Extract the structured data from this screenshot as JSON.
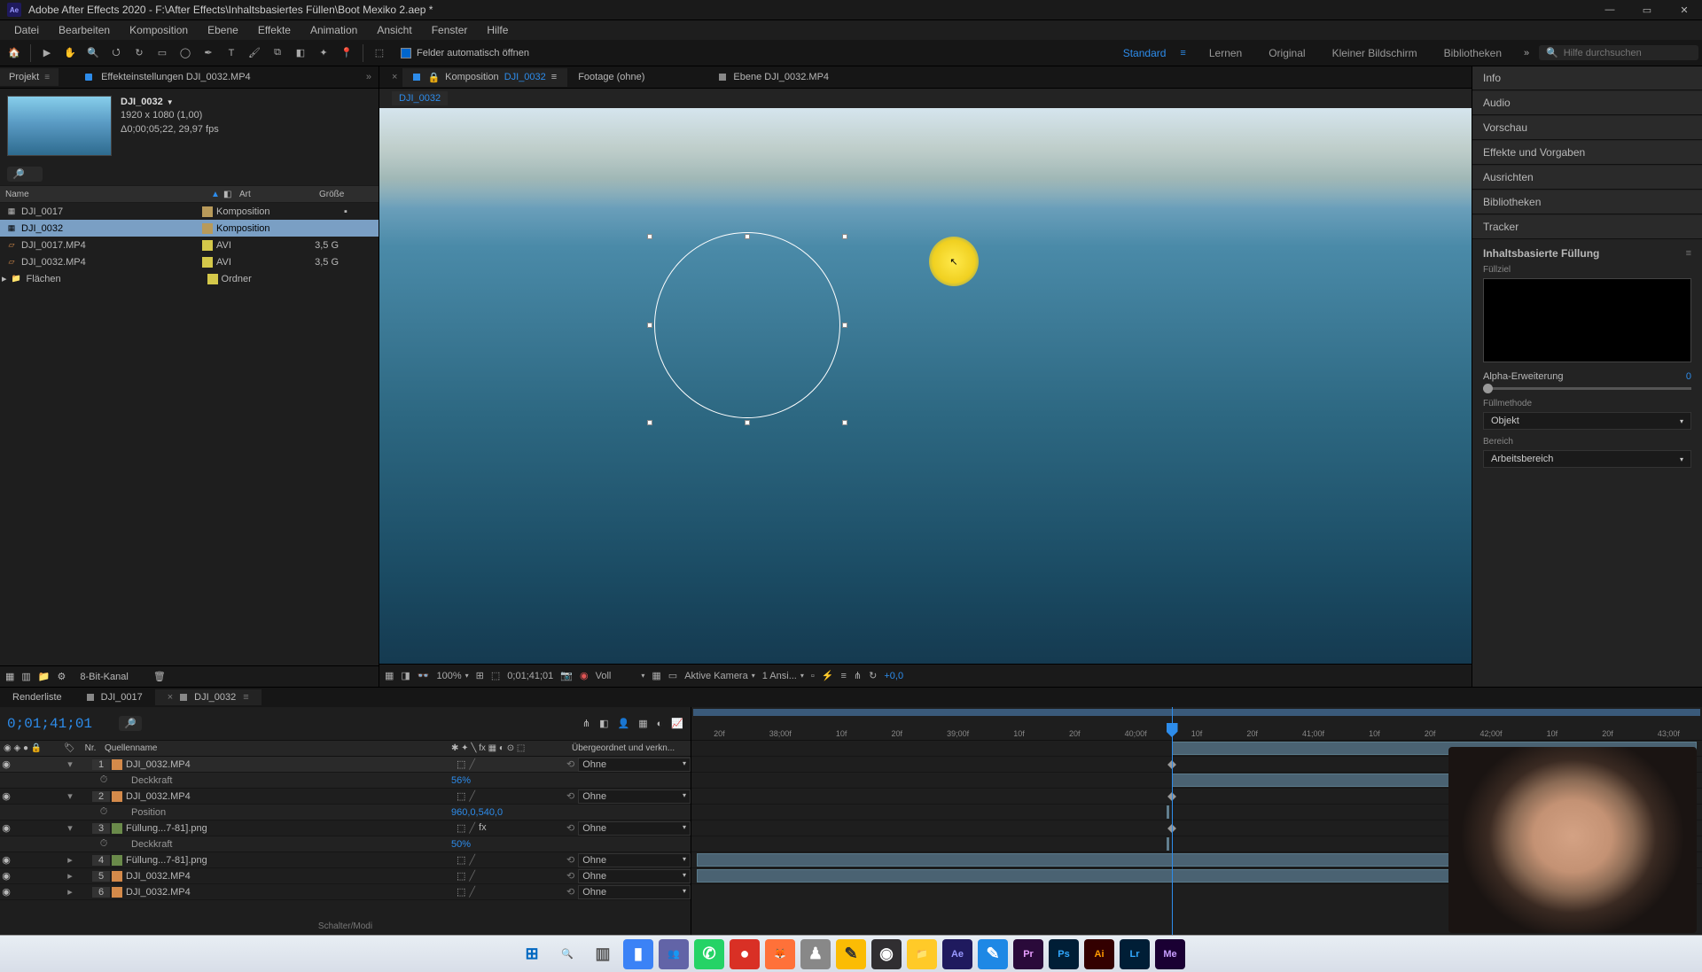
{
  "window": {
    "title": "Adobe After Effects 2020 - F:\\After Effects\\Inhaltsbasiertes Füllen\\Boot Mexiko 2.aep *",
    "app_abbrev": "Ae"
  },
  "menu": [
    "Datei",
    "Bearbeiten",
    "Komposition",
    "Ebene",
    "Effekte",
    "Animation",
    "Ansicht",
    "Fenster",
    "Hilfe"
  ],
  "toolbar": {
    "auto_open_fields": "Felder automatisch öffnen",
    "workspaces": [
      "Standard",
      "Lernen",
      "Original",
      "Kleiner Bildschirm",
      "Bibliotheken"
    ],
    "active_workspace": "Standard",
    "search_placeholder": "Hilfe durchsuchen"
  },
  "project_panel": {
    "tab_project": "Projekt",
    "tab_effect_controls": "Effekteinstellungen DJI_0032.MP4",
    "comp_name": "DJI_0032",
    "resolution": "1920 x 1080 (1,00)",
    "duration": "Δ0;00;05;22, 29,97 fps",
    "columns": {
      "name": "Name",
      "type": "Art",
      "size": "Größe"
    },
    "items": [
      {
        "name": "DJI_0017",
        "type": "Komposition",
        "size": "",
        "color": "#b89a5a",
        "icon": "comp"
      },
      {
        "name": "DJI_0032",
        "type": "Komposition",
        "size": "",
        "color": "#b89a5a",
        "icon": "comp",
        "selected": true
      },
      {
        "name": "DJI_0017.MP4",
        "type": "AVI",
        "size": "3,5 G",
        "color": "#d4c84a",
        "icon": "footage"
      },
      {
        "name": "DJI_0032.MP4",
        "type": "AVI",
        "size": "3,5 G",
        "color": "#d4c84a",
        "icon": "footage"
      },
      {
        "name": "Flächen",
        "type": "Ordner",
        "size": "",
        "color": "#d4c84a",
        "icon": "folder"
      }
    ],
    "footer_label": "8-Bit-Kanal"
  },
  "composition_panel": {
    "tab_comp_prefix": "Komposition",
    "tab_comp_name": "DJI_0032",
    "tab_footage": "Footage (ohne)",
    "tab_layer": "Ebene DJI_0032.MP4",
    "breadcrumb": "DJI_0032",
    "footer": {
      "zoom": "100%",
      "timecode": "0;01;41;01",
      "resolution": "Voll",
      "camera": "Aktive Kamera",
      "views": "1 Ansi...",
      "exposure": "+0,0"
    }
  },
  "right_panel": {
    "sections": [
      "Info",
      "Audio",
      "Vorschau",
      "Effekte und Vorgaben",
      "Ausrichten",
      "Bibliotheken",
      "Tracker"
    ],
    "caf": {
      "title": "Inhaltsbasierte Füllung",
      "fill_target": "Füllziel",
      "alpha_label": "Alpha-Erweiterung",
      "alpha_value": "0",
      "method_label": "Füllmethode",
      "method_value": "Objekt",
      "range_label": "Bereich",
      "range_value": "Arbeitsbereich"
    }
  },
  "timeline": {
    "tab_render": "Renderliste",
    "tab_comp1": "DJI_0017",
    "tab_comp2": "DJI_0032",
    "timecode": "0;01;41;01",
    "col_nr": "Nr.",
    "col_source": "Quellenname",
    "col_parent": "Übergeordnet und verkn...",
    "parent_none": "Ohne",
    "opacity_label": "Deckkraft",
    "position_label": "Position",
    "position_value": "960,0,540,0",
    "footer_toggle": "Schalter/Modi",
    "time_marks": [
      "20f",
      "38;00f",
      "10f",
      "20f",
      "39;00f",
      "10f",
      "20f",
      "40;00f",
      "10f",
      "20f",
      "41;00f",
      "10f",
      "20f",
      "42;00f",
      "10f",
      "20f",
      "43;00f"
    ],
    "layers": [
      {
        "num": "1",
        "name": "DJI_0032.MP4",
        "color": "#b8526a",
        "icon": "footage",
        "sub": {
          "kind": "opacity",
          "value": "56%"
        }
      },
      {
        "num": "2",
        "name": "DJI_0032.MP4",
        "color": "#b8526a",
        "icon": "footage",
        "sub": {
          "kind": "position"
        }
      },
      {
        "num": "3",
        "name": "Füllung...7-81].png",
        "color": "#b85a8a",
        "icon": "seq",
        "sub": {
          "kind": "opacity",
          "value": "50%"
        }
      },
      {
        "num": "4",
        "name": "Füllung...7-81].png",
        "color": "#b85a8a",
        "icon": "seq"
      },
      {
        "num": "5",
        "name": "DJI_0032.MP4",
        "color": "#b8526a",
        "icon": "footage"
      },
      {
        "num": "6",
        "name": "DJI_0032.MP4",
        "color": "#b8526a",
        "icon": "footage"
      }
    ]
  },
  "taskbar_icons": [
    {
      "name": "start",
      "bg": "transparent",
      "fg": "#0067c0",
      "glyph": "⊞"
    },
    {
      "name": "search",
      "bg": "transparent",
      "fg": "#555",
      "glyph": "🔍"
    },
    {
      "name": "taskview",
      "bg": "transparent",
      "fg": "#555",
      "glyph": "▥"
    },
    {
      "name": "widgets",
      "bg": "#3b82f6",
      "fg": "#fff",
      "glyph": "▮"
    },
    {
      "name": "teams",
      "bg": "#6264a7",
      "fg": "#fff",
      "glyph": "👥"
    },
    {
      "name": "whatsapp",
      "bg": "#25d366",
      "fg": "#fff",
      "glyph": "✆"
    },
    {
      "name": "red-app",
      "bg": "#d93025",
      "fg": "#fff",
      "glyph": "●"
    },
    {
      "name": "firefox",
      "bg": "#ff7139",
      "fg": "#fff",
      "glyph": "🦊"
    },
    {
      "name": "misc1",
      "bg": "#888",
      "fg": "#fff",
      "glyph": "♟"
    },
    {
      "name": "notes",
      "bg": "#fbbc04",
      "fg": "#333",
      "glyph": "✎"
    },
    {
      "name": "obs",
      "bg": "#302e31",
      "fg": "#fff",
      "glyph": "◉"
    },
    {
      "name": "explorer",
      "bg": "#ffca28",
      "fg": "#7a5c00",
      "glyph": "📁"
    },
    {
      "name": "after-effects",
      "bg": "#1f1a5e",
      "fg": "#9999ff",
      "glyph": "Ae"
    },
    {
      "name": "blue-app",
      "bg": "#1e88e5",
      "fg": "#fff",
      "glyph": "✎"
    },
    {
      "name": "premiere",
      "bg": "#2a0a3a",
      "fg": "#e89eff",
      "glyph": "Pr"
    },
    {
      "name": "photoshop",
      "bg": "#001e36",
      "fg": "#31a8ff",
      "glyph": "Ps"
    },
    {
      "name": "illustrator",
      "bg": "#330000",
      "fg": "#ff9a00",
      "glyph": "Ai"
    },
    {
      "name": "lightroom",
      "bg": "#001e36",
      "fg": "#31a8ff",
      "glyph": "Lr"
    },
    {
      "name": "media-encoder",
      "bg": "#1a0033",
      "fg": "#c89eff",
      "glyph": "Me"
    }
  ]
}
